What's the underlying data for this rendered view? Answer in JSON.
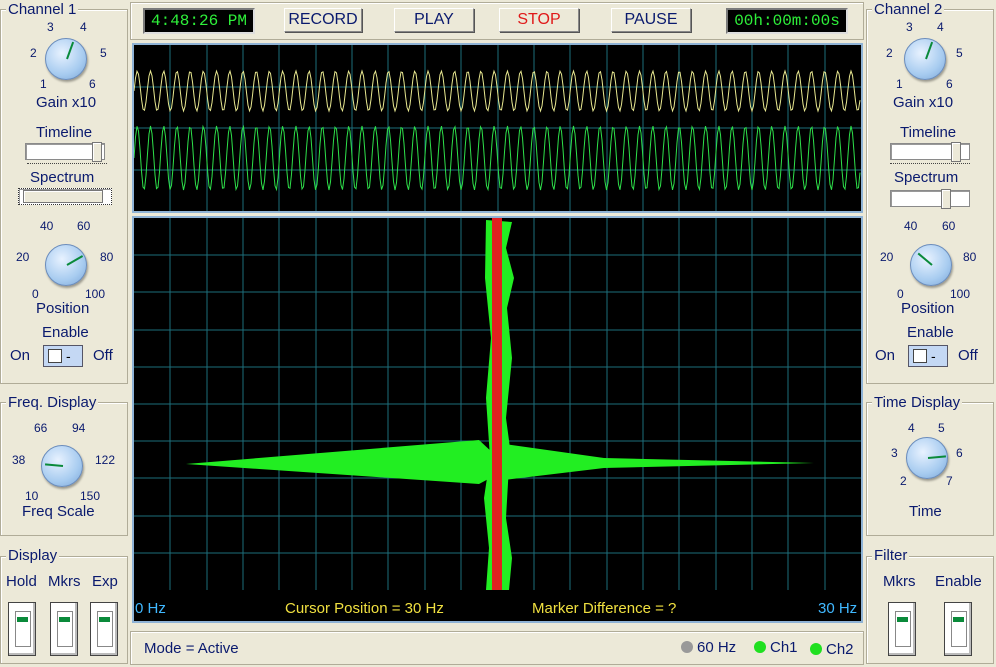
{
  "channel1": {
    "title": "Channel 1",
    "gain_ticks": [
      "3",
      "4",
      "2",
      "5",
      "1",
      "6"
    ],
    "gain_label": "Gain x10",
    "gain_pct": 0.55,
    "timeline_label": "Timeline",
    "timeline_pct": 0.92,
    "spectrum_label": "Spectrum",
    "spectrum_pct": 0.0,
    "pos_ticks": [
      "40",
      "60",
      "20",
      "80",
      "0",
      "100"
    ],
    "position_label": "Position",
    "position_pct": 0.72,
    "enable_label": "Enable",
    "on": "On",
    "off": "Off",
    "toggle_text": "-"
  },
  "channel2": {
    "title": "Channel 2",
    "gain_ticks": [
      "3",
      "4",
      "2",
      "5",
      "1",
      "6"
    ],
    "gain_label": "Gain x10",
    "gain_pct": 0.55,
    "timeline_label": "Timeline",
    "timeline_pct": 0.92,
    "spectrum_label": "Spectrum",
    "spectrum_pct": 0.72,
    "pos_ticks": [
      "40",
      "60",
      "20",
      "80",
      "0",
      "100"
    ],
    "position_label": "Position",
    "position_pct": 0.3,
    "enable_label": "Enable",
    "on": "On",
    "off": "Off",
    "toggle_text": "-"
  },
  "freq_display": {
    "title": "Freq. Display",
    "ticks": [
      "66",
      "94",
      "38",
      "122",
      "10",
      "150"
    ],
    "label": "Freq Scale"
  },
  "time_display": {
    "title": "Time Display",
    "ticks": [
      "4",
      "5",
      "3",
      "6",
      "2",
      "7"
    ],
    "label": "Time"
  },
  "display_group": {
    "title": "Display",
    "hold": "Hold",
    "mkrs": "Mkrs",
    "exp": "Exp"
  },
  "filter_group": {
    "title": "Filter",
    "mkrs": "Mkrs",
    "enable": "Enable"
  },
  "toolbar": {
    "clock": "4:48:26 PM",
    "record": "RECORD",
    "play": "PLAY",
    "stop": "STOP",
    "pause": "PAUSE",
    "timer": "00h:00m:00s"
  },
  "spectrum": {
    "left_freq": "0 Hz",
    "cursor": "Cursor Position = 30 Hz",
    "marker": "Marker Difference = ?",
    "right_freq": "30 Hz"
  },
  "status": {
    "mode": "Mode =  Active",
    "hz60": "60 Hz",
    "ch1": "Ch1",
    "ch2": "Ch2"
  },
  "colors": {
    "ch1_wave": "#e8e890",
    "ch2_wave": "#2ee04a",
    "spectrum": "#22ee22",
    "cursor": "#e02020",
    "grid": "#1d6e7a"
  }
}
